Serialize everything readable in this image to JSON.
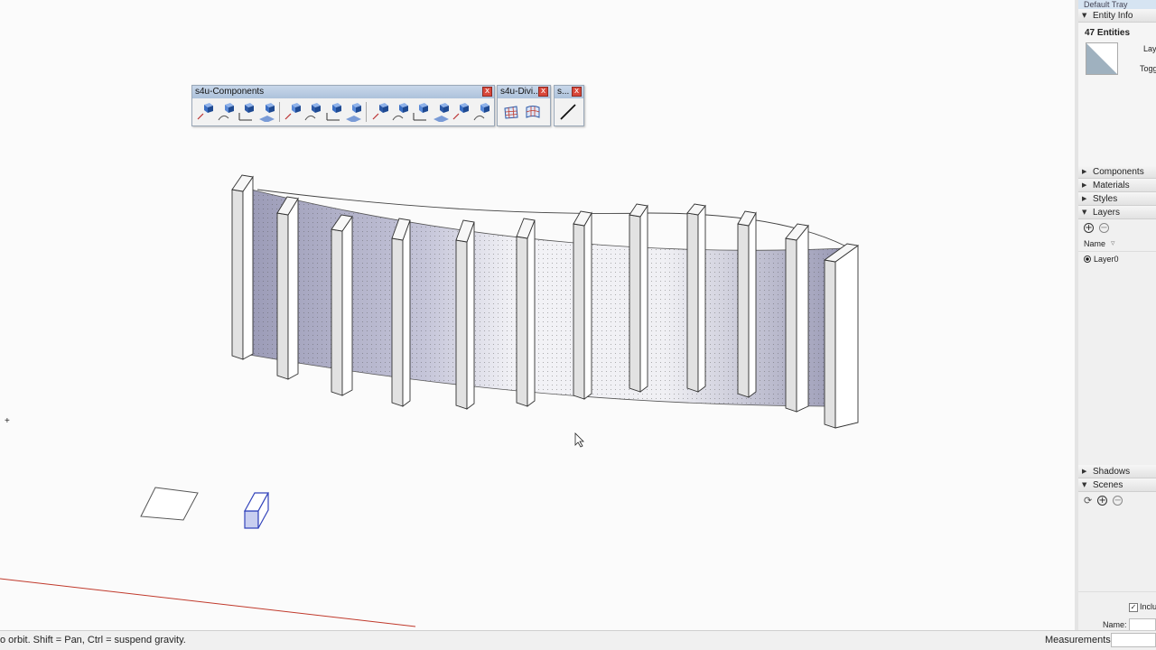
{
  "toolbars": {
    "components": {
      "title": "s4u-Components",
      "close": "x"
    },
    "divide": {
      "title": "s4u-Divi...",
      "close": "x"
    },
    "small": {
      "title": "s...",
      "close": "x"
    }
  },
  "icons": {
    "components": [
      "component-tool-1-icon",
      "component-tool-2-icon",
      "component-tool-3-icon",
      "component-tool-4-icon",
      "component-tool-5-icon",
      "component-tool-6-icon",
      "component-tool-7-icon",
      "component-tool-8-icon",
      "component-tool-9-icon",
      "component-tool-10-icon",
      "component-tool-11-icon",
      "component-tool-12-icon",
      "component-tool-13-icon",
      "component-tool-14-icon"
    ],
    "divide": [
      "divide-grid-icon",
      "divide-curved-grid-icon"
    ],
    "small": [
      "line-tool-icon"
    ]
  },
  "tray": {
    "title": "Default Tray",
    "entity_info": {
      "header": "Entity Info",
      "count": "47 Entities",
      "layer_label": "Lay",
      "toggle_label": "Toggl"
    },
    "panels": [
      {
        "label": "Components",
        "expanded": false
      },
      {
        "label": "Materials",
        "expanded": false
      },
      {
        "label": "Styles",
        "expanded": false
      },
      {
        "label": "Layers",
        "expanded": true
      }
    ],
    "layers": {
      "name_col": "Name",
      "items": [
        "Layer0"
      ]
    },
    "panels2": [
      {
        "label": "Shadows",
        "expanded": false
      },
      {
        "label": "Scenes",
        "expanded": true
      }
    ],
    "bottom": {
      "include_label": "Inclu",
      "name_label": "Name:"
    }
  },
  "status": {
    "message": "o orbit. Shift = Pan, Ctrl = suspend gravity.",
    "measurements_label": "Measurements"
  },
  "colors": {
    "axis_red": "#c0392b",
    "panel_fill_dark": "#b8b8cc",
    "panel_fill_light": "#f4f4f4",
    "selection_blue": "#3344bb"
  }
}
